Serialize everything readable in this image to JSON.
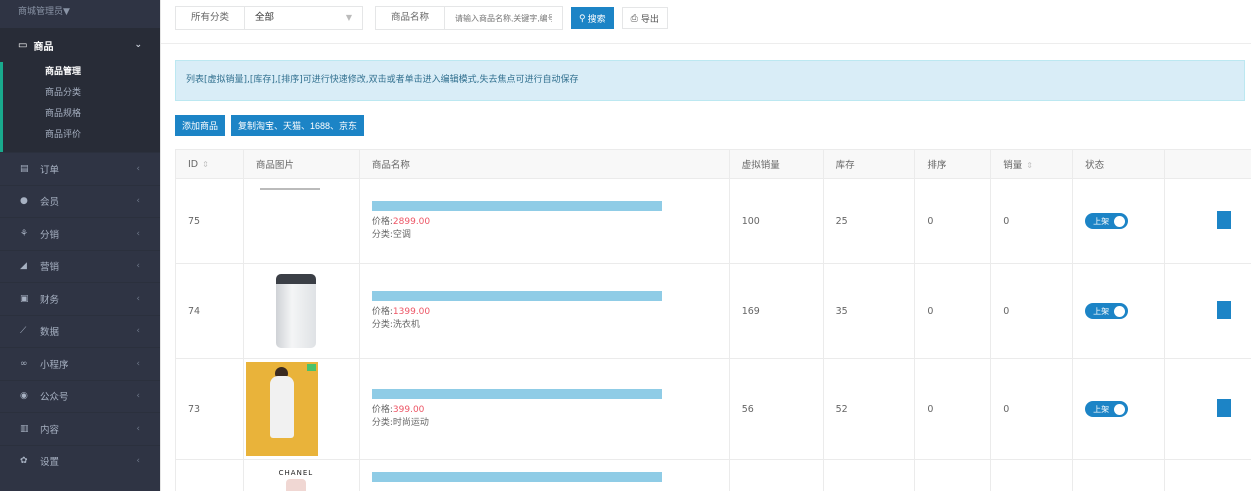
{
  "sidebar": {
    "top_label": "商城管理员▼",
    "group": {
      "label": "商品",
      "icon": "box-icon",
      "sub": [
        "商品管理",
        "商品分类",
        "商品规格",
        "商品评价"
      ]
    },
    "items": [
      {
        "label": "订单",
        "icon": "list-icon"
      },
      {
        "label": "会员",
        "icon": "user-icon"
      },
      {
        "label": "分销",
        "icon": "sitemap-icon"
      },
      {
        "label": "营销",
        "icon": "paper-plane-icon"
      },
      {
        "label": "财务",
        "icon": "money-icon"
      },
      {
        "label": "数据",
        "icon": "chart-line-icon"
      },
      {
        "label": "小程序",
        "icon": "weixin-mini-icon"
      },
      {
        "label": "公众号",
        "icon": "wechat-icon"
      },
      {
        "label": "内容",
        "icon": "book-icon"
      },
      {
        "label": "设置",
        "icon": "gear-icon"
      }
    ]
  },
  "toolbar": {
    "category_label": "所有分类",
    "category_value": "全部",
    "name_label": "商品名称",
    "name_placeholder": "请输入商品名称,关键字,编号",
    "search_label": "搜索",
    "export_label": "导出"
  },
  "alert": "列表[虚拟销量],[库存],[排序]可进行快速修改,双击或者单击进入编辑模式,失去焦点可进行自动保存",
  "actions": {
    "add_label": "添加商品",
    "copy_label": "复制淘宝、天猫、1688、京东"
  },
  "table": {
    "headers": [
      "ID",
      "商品图片",
      "商品名称",
      "虚拟销量",
      "库存",
      "排序",
      "销量",
      "状态"
    ],
    "price_prefix": "价格:",
    "cat_prefix": "分类:",
    "status_label": "上架",
    "rows": [
      {
        "id": "75",
        "price": "2899.00",
        "category": "空调",
        "virtual_sales": "100",
        "stock": "25",
        "sort": "0",
        "sales": "0",
        "image": "document"
      },
      {
        "id": "74",
        "price": "1399.00",
        "category": "洗衣机",
        "virtual_sales": "169",
        "stock": "35",
        "sort": "0",
        "sales": "0",
        "image": "washer"
      },
      {
        "id": "73",
        "price": "399.00",
        "category": "时尚运动",
        "virtual_sales": "56",
        "stock": "52",
        "sort": "0",
        "sales": "0",
        "image": "fashion"
      }
    ],
    "partial_row_brand": "CHANEL"
  },
  "colors": {
    "primary": "#1c84c6",
    "sidebar_bg": "#2f3444",
    "alert_bg": "#d9edf7",
    "price": "#ed5565"
  }
}
